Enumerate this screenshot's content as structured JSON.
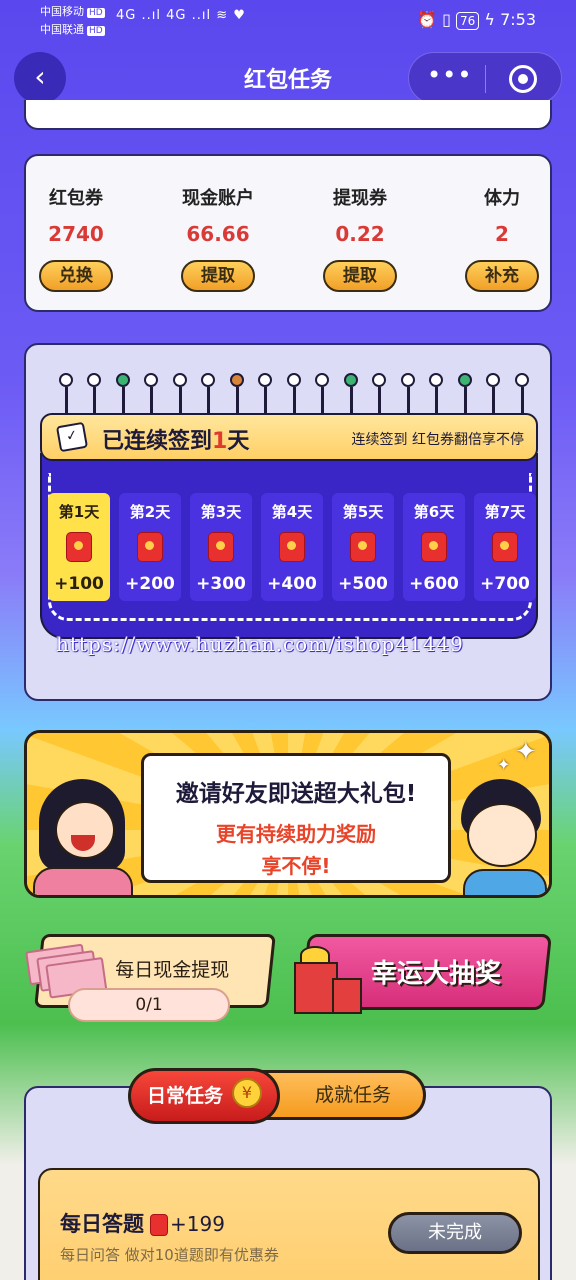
{
  "status_bar": {
    "carrier1": "中国移动",
    "carrier2": "中国联通",
    "hd": "HD",
    "signal": "4G ..ıl 4G ..ıl ≋ ♥",
    "right_icons": "⏰ ▯",
    "battery": "76",
    "time": "7:53"
  },
  "nav": {
    "back_icon": "‹",
    "title": "红包任务",
    "more_icon": "•••"
  },
  "accounts": [
    {
      "label": "红包券",
      "value": "2740",
      "button": "兑换"
    },
    {
      "label": "现金账户",
      "value": "66.66",
      "button": "提取"
    },
    {
      "label": "提现券",
      "value": "0.22",
      "button": "提取"
    },
    {
      "label": "体力",
      "value": "2",
      "button": "补充"
    }
  ],
  "signin": {
    "title_prefix": "已连续签到",
    "title_days": "1",
    "title_suffix": "天",
    "subtitle": "连续签到 红包券翻倍享不停",
    "calendar_icon": "✓",
    "days": [
      {
        "label": "第1天",
        "reward": "+100"
      },
      {
        "label": "第2天",
        "reward": "+200"
      },
      {
        "label": "第3天",
        "reward": "+300"
      },
      {
        "label": "第4天",
        "reward": "+400"
      },
      {
        "label": "第5天",
        "reward": "+500"
      },
      {
        "label": "第6天",
        "reward": "+600"
      },
      {
        "label": "第7天",
        "reward": "+700"
      }
    ]
  },
  "watermark": "https://www.huzhan.com/ishop41449",
  "invite": {
    "line1": "邀请好友即送超大礼包!",
    "line2": "更有持续助力奖励",
    "line3": "享不停!"
  },
  "daily_cash": {
    "title": "每日现金提现",
    "progress": "0/1"
  },
  "lottery": {
    "title": "幸运大抽奖"
  },
  "tabs": {
    "daily": "日常任务",
    "coin": "¥",
    "achievement": "成就任务"
  },
  "task": {
    "title": "每日答题",
    "reward": "+199",
    "desc": "每日问答 做对10道题即有优惠券",
    "button": "未完成"
  },
  "colors": {
    "primary": "#5a48ee",
    "accent_red": "#d93a35",
    "button_gold": "#f0a028"
  }
}
